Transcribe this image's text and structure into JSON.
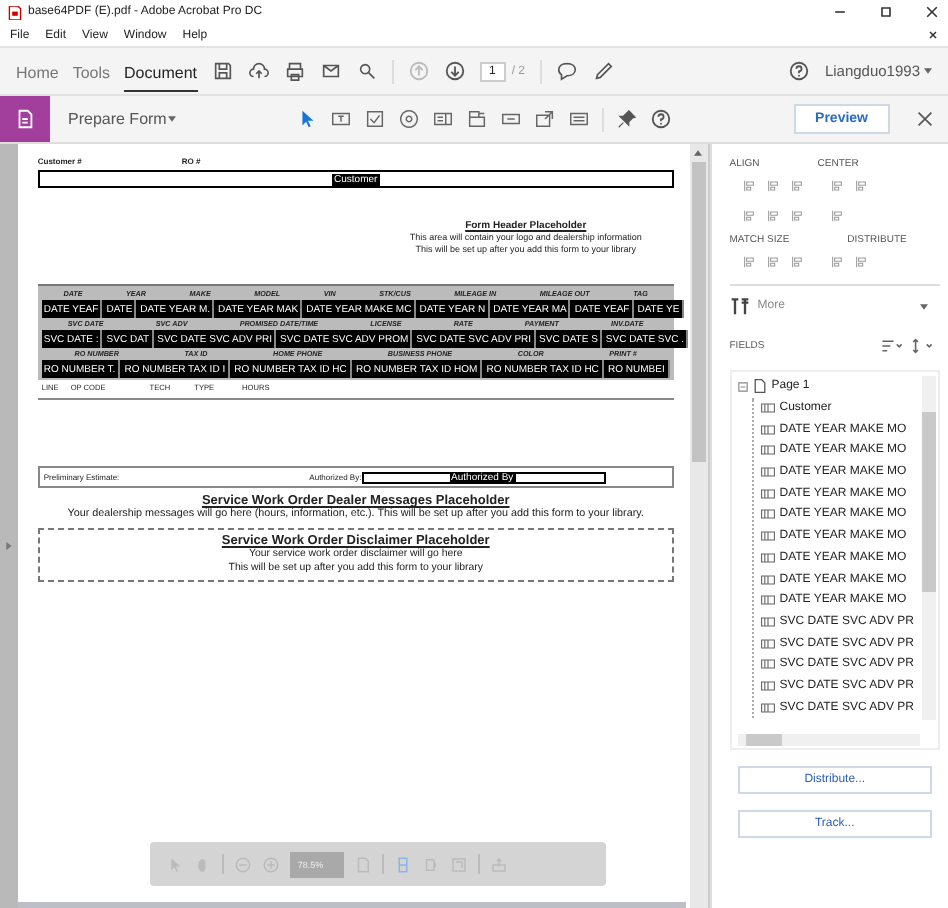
{
  "window": {
    "title": "base64PDF (E).pdf - Adobe Acrobat Pro DC"
  },
  "menu": [
    "File",
    "Edit",
    "View",
    "Window",
    "Help"
  ],
  "tabs": [
    {
      "label": "Home",
      "selected": false
    },
    {
      "label": "Tools",
      "selected": false
    },
    {
      "label": "Document",
      "selected": true
    }
  ],
  "page_nav": {
    "current": "1",
    "total": "/ 2"
  },
  "user": "Liangduo1993",
  "prepare_form": {
    "title": "Prepare Form",
    "preview": "Preview"
  },
  "document": {
    "customer_no_label": "Customer #",
    "ro_label": "RO #",
    "customer_field": "Customer",
    "header_placeholder": {
      "title": "Form Header Placeholder",
      "lines": [
        "This area will contain your logo and dealership information",
        "This will be set up after you add this form to your library"
      ]
    },
    "table_rows": [
      {
        "kind": "header",
        "cells": [
          "DATE",
          "YEAR",
          "MAKE",
          "MODEL",
          "VIN",
          "STK/CUS",
          "MILEAGE IN",
          "MILEAGE OUT",
          "TAG"
        ]
      },
      {
        "kind": "data",
        "cells": [
          "DATE YEAF",
          "DATE",
          "DATE YEAR M.",
          "DATE YEAR MAK",
          "DATE YEAR MAKE MC",
          "DATE YEAR N",
          "DATE YEAR MA",
          "DATE YEAF",
          "DATE YE"
        ]
      },
      {
        "kind": "header",
        "cells": [
          "SVC DATE",
          "SVC ADV",
          "PROMISED DATE/TIME",
          "LICENSE",
          "RATE",
          "PAYMENT",
          "INV.DATE"
        ]
      },
      {
        "kind": "data",
        "cells": [
          "SVC DATE :",
          "SVC DAT",
          "SVC DATE SVC ADV PRI",
          "SVC DATE SVC ADV PROM",
          "SVC DATE SVC ADV PRI",
          "SVC DATE S",
          "SVC DATE SVC ."
        ]
      },
      {
        "kind": "header",
        "cells": [
          "RO NUMBER",
          "TAX ID",
          "HOME PHONE",
          "BUSINESS PHONE",
          "COLOR",
          "PRINT #"
        ]
      },
      {
        "kind": "data",
        "cells": [
          "RO NUMBER T.",
          "RO NUMBER TAX ID I",
          "RO NUMBER TAX ID HC",
          "RO NUMBER TAX ID HOM",
          "RO NUMBER TAX ID HC",
          "RO NUMBEI"
        ]
      }
    ],
    "line_columns": [
      "LINE",
      "OP CODE",
      "TECH",
      "TYPE",
      "HOURS"
    ],
    "estimate": {
      "label": "Preliminary Estimate:",
      "authorized_label": "Authorized By:",
      "authorized_field": "Authorized By"
    },
    "messages": {
      "title": "Service Work Order Dealer Messages Placeholder",
      "text": "Your dealership messages will go here (hours, information, etc.).  This will be set up after you add this form to your library."
    },
    "disclaimer": {
      "title": "Service Work Order Disclaimer Placeholder",
      "lines": [
        "Your service work order disclaimer will go here",
        "This will be set up after you add this form to your library"
      ]
    }
  },
  "zoom_bar": {
    "zoom": "78.5%"
  },
  "right_panel": {
    "align": "ALIGN",
    "center": "CENTER",
    "match_size": "MATCH SIZE",
    "distribute": "DISTRIBUTE",
    "more": "More",
    "fields": "FIELDS",
    "tree": {
      "label": "Page 1",
      "children": [
        {
          "label": "Customer"
        },
        {
          "label": "DATE YEAR MAKE MO"
        },
        {
          "label": "DATE YEAR MAKE MO"
        },
        {
          "label": "DATE YEAR MAKE MO"
        },
        {
          "label": "DATE YEAR MAKE MO"
        },
        {
          "label": "DATE YEAR MAKE MO"
        },
        {
          "label": "DATE YEAR MAKE MO"
        },
        {
          "label": "DATE YEAR MAKE MO"
        },
        {
          "label": "DATE YEAR MAKE MO"
        },
        {
          "label": "DATE YEAR MAKE MO"
        },
        {
          "label": "SVC DATE SVC ADV PR"
        },
        {
          "label": "SVC DATE SVC ADV PR"
        },
        {
          "label": "SVC DATE SVC ADV PR"
        },
        {
          "label": "SVC DATE SVC ADV PR"
        },
        {
          "label": "SVC DATE SVC ADV PR"
        }
      ]
    },
    "buttons": [
      "Distribute...",
      "Track..."
    ]
  }
}
